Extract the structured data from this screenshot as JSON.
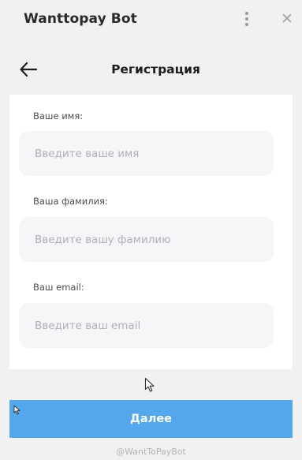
{
  "window": {
    "title": "Wanttopay Bot"
  },
  "header": {
    "back_icon": "arrow-left-icon",
    "title": "Регистрация"
  },
  "form": {
    "fields": [
      {
        "label": "Ваше имя:",
        "placeholder": "Введите ваше имя",
        "value": ""
      },
      {
        "label": "Ваша фамилия:",
        "placeholder": "Введите вашу фамилию",
        "value": ""
      },
      {
        "label": "Ваш email:",
        "placeholder": "Введите ваш email",
        "value": ""
      }
    ]
  },
  "actions": {
    "next_label": "Далее"
  },
  "footer": {
    "bot_handle": "@WantToPayBot"
  },
  "colors": {
    "accent": "#55a7ec",
    "background": "#f1f1f2",
    "field_bg": "#f6f6f8",
    "placeholder": "#b0b0b5"
  }
}
